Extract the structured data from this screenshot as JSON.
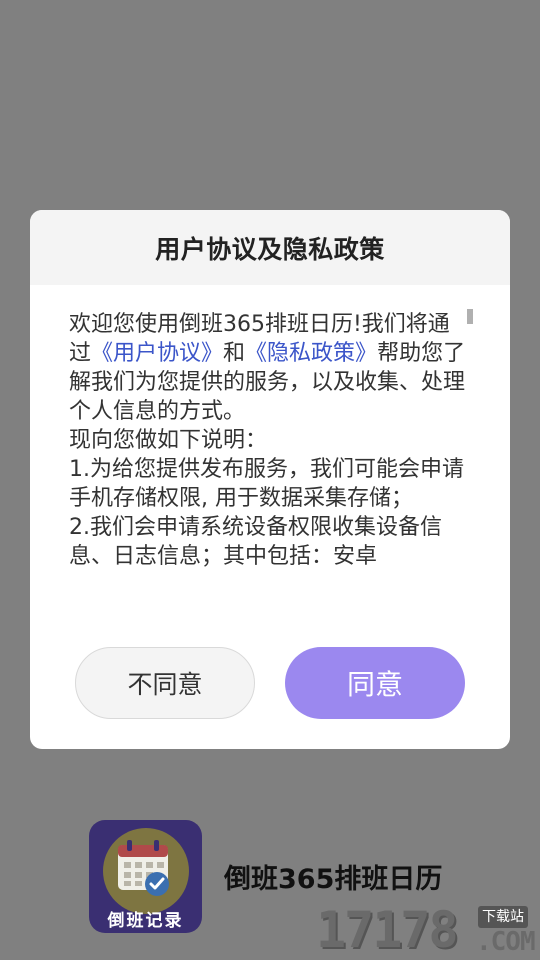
{
  "dialog": {
    "title": "用户协议及隐私政策",
    "body": {
      "p1_before": "欢迎您使用倒班365排班日历!我们将通过",
      "link_agreement": "《用户协议》",
      "p1_mid": "和",
      "link_privacy": "《隐私政策》",
      "p1_after": "帮助您了解我们为您提供的服务，以及收集、处理个人信息的方式。",
      "p2": "现向您做如下说明：",
      "p3": "1.为给您提供发布服务，我们可能会申请手机存储权限, 用于数据采集存储；",
      "p4": "2.我们会申请系统设备权限收集设备信息、日志信息；其中包括：安卓"
    },
    "decline_label": "不同意",
    "accept_label": "同意"
  },
  "splash": {
    "logo_label": "倒班记录",
    "app_name": "倒班365排班日历"
  },
  "watermark": {
    "digits": "17178",
    "domain": ".COM",
    "tag": "下载站"
  },
  "colors": {
    "overlay": "#808080",
    "accent": "#9b88ef",
    "link": "#3b55c9"
  }
}
